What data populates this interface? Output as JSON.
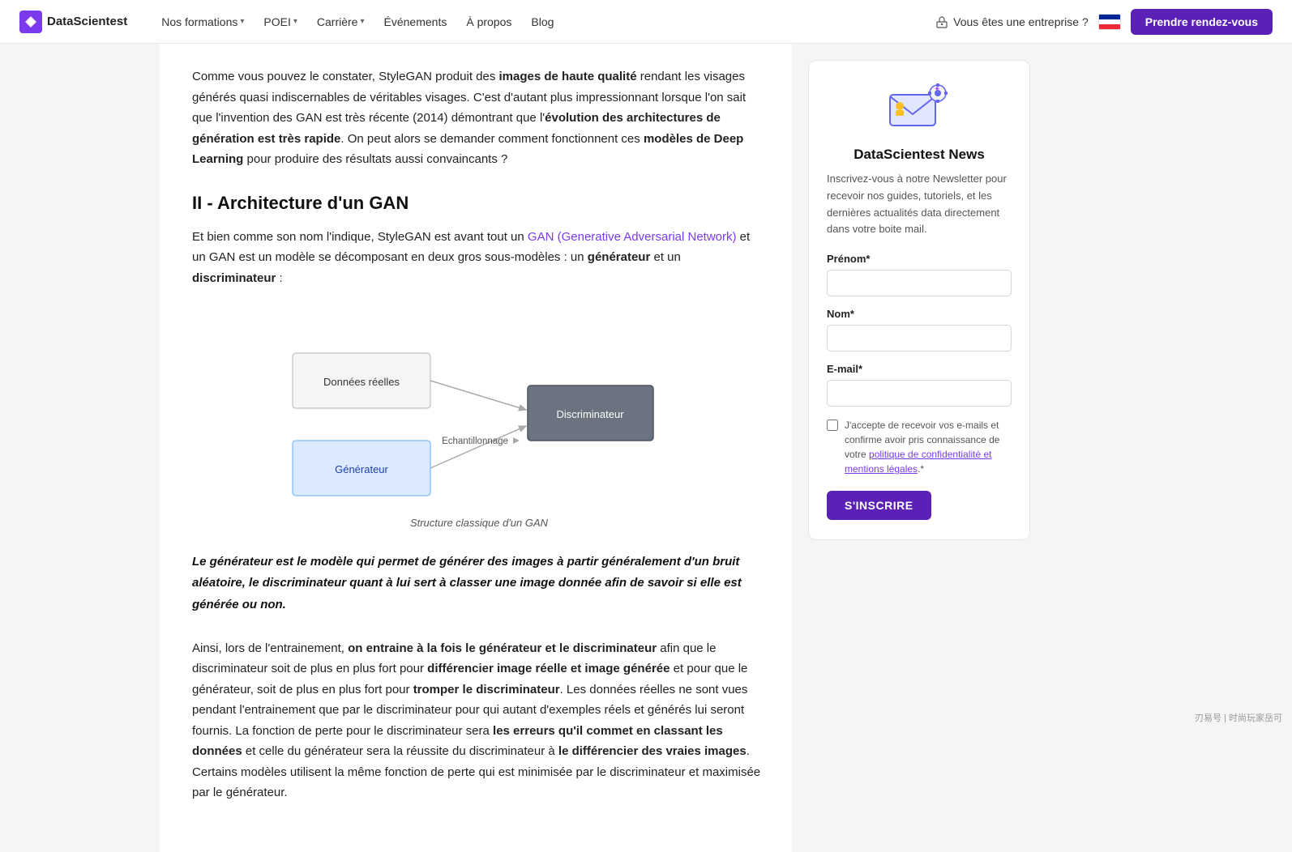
{
  "nav": {
    "logo_text": "DataScientest",
    "formations_label": "Nos formations",
    "poei_label": "POEI",
    "carriere_label": "Carrière",
    "evenements_label": "Événements",
    "apropos_label": "À propos",
    "blog_label": "Blog",
    "enterprise_label": "Vous êtes une entreprise ?",
    "cta_label": "Prendre rendez-vous"
  },
  "main": {
    "intro_text_1": "Comme vous pouvez le constater, StyleGAN produit des ",
    "intro_bold_1": "images de haute qualité",
    "intro_text_2": " rendant les visages générés quasi indiscernables de véritables visages. C'est d'autant plus impressionnant lorsque l'on sait que l'invention des GAN est très récente (2014) démontrant que l'",
    "intro_bold_2": "évolution des architectures de génération est très rapide",
    "intro_text_3": ". On peut alors se demander comment fonctionnent ces ",
    "intro_bold_3": "modèles de Deep Learning",
    "intro_text_4": " pour produire des résultats aussi convaincants ?",
    "section_title": "II - Architecture d'un GAN",
    "section_para_1_text_1": "Et bien comme son nom l'indique, StyleGAN est avant tout un ",
    "section_para_1_link": "GAN (Generative Adversarial Network)",
    "section_para_1_text_2": " et un GAN est un modèle se décomposant en deux gros sous-modèles : un ",
    "section_para_1_bold_1": "générateur",
    "section_para_1_text_3": " et un ",
    "section_para_1_bold_2": "discriminateur",
    "section_para_1_text_4": " :",
    "diagram_label_donnees": "Données réelles",
    "diagram_label_generateur": "Générateur",
    "diagram_label_echantillonnage": "Echantillonnage",
    "diagram_label_discriminateur": "Discriminateur",
    "diagram_caption": "Structure classique d'un GAN",
    "quote": "Le générateur est le modèle qui permet de générer des images à partir généralement d'un bruit aléatoire, le discriminateur quant à lui sert à classer une image donnée afin de savoir si elle est générée ou non.",
    "body_para_1_text_1": "Ainsi, lors de l'entrainement, ",
    "body_para_1_bold_1": "on entraine à la fois le générateur et le discriminateur",
    "body_para_1_text_2": " afin que le discriminateur soit de plus en plus fort pour ",
    "body_para_1_bold_2": "différencier image réelle et image générée",
    "body_para_1_text_3": " et pour que le générateur, soit de plus en plus fort pour ",
    "body_para_1_bold_3": "tromper le discriminateur",
    "body_para_1_text_4": ". Les données réelles ne sont vues pendant l'entrainement que par le discriminateur pour qui autant d'exemples réels et générés lui seront fournis. La fonction de perte pour le discriminateur sera ",
    "body_para_1_bold_4": "les erreurs qu'il commet en classant les données",
    "body_para_1_text_5": " et celle du générateur sera la réussite du discriminateur à ",
    "body_para_1_bold_5": "le différencier des vraies images",
    "body_para_1_text_6": ". Certains modèles utilisent la même fonction de perte qui est minimisée par le discriminateur et maximisée par le générateur."
  },
  "sidebar": {
    "title": "DataScientest News",
    "description": "Inscrivez-vous à notre Newsletter pour recevoir nos guides, tutoriels, et les dernières actualités data directement dans votre boite mail.",
    "prenom_label": "Prénom*",
    "nom_label": "Nom*",
    "email_label": "E-mail*",
    "prenom_placeholder": "",
    "nom_placeholder": "",
    "email_placeholder": "",
    "checkbox_text": "J'accepte de recevoir vos e-mails et confirme avoir pris connaissance de votre politique de confidentialité et mentions légales.*",
    "submit_label": "S'INSCRIRE"
  },
  "watermark": "刃易号 | 时尚玩家岳可"
}
